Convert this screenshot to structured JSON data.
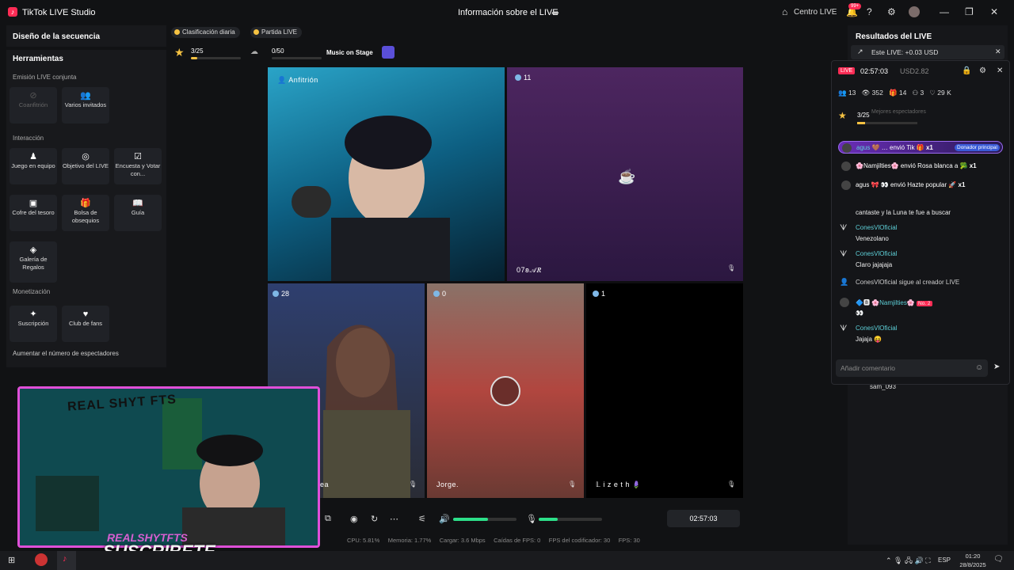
{
  "app": {
    "title": "TikTok LIVE Studio",
    "logo": "tiktok-logo"
  },
  "header": {
    "center_title": "Información sobre el LIVE",
    "centro": "Centro LIVE",
    "notif_badge": "99+"
  },
  "sidebar": {
    "sequence_title": "Diseño de la secuencia",
    "tools_title": "Herramientas",
    "joint_live": "Emisión LIVE conjunta",
    "cohost": "Coanfitrión",
    "multi_guest": "Varios invitados",
    "interaction": "Interacción",
    "team_game": "Juego en equipo",
    "live_goal": "Objetivo del LIVE",
    "poll": "Encuesta y Votar con...",
    "treasure": "Cofre del tesoro",
    "gift_bag": "Bolsa de obsequios",
    "guide": "Guía",
    "gift_gallery": "Galería de Regalos",
    "monetization": "Monetización",
    "subscription": "Suscripción",
    "fan_club": "Club de fans",
    "increase_viewers": "Aumentar el número de espectadores"
  },
  "chips": {
    "daily_rank": "Clasificación diaria",
    "live_match": "Partida LIVE"
  },
  "goals": {
    "stars": "3/25",
    "progress": "0/50",
    "music": "Music on Stage"
  },
  "grid": {
    "host_label": "Anfitrión",
    "guest1_viewers": "11",
    "guest1_name": "07𐐪𝒜𝑅",
    "guest2_viewers": "28",
    "guest2_name": "ea",
    "guest3_viewers": "0",
    "guest3_name": "Jorge.",
    "guest4_viewers": "1",
    "guest4_name": "𝕃 i z e t h 🪻",
    "banner_real": "REAL SHYT FTS"
  },
  "controls": {
    "timer": "02:57:03",
    "volume_pct": 0.55,
    "mic_pct": 0.3
  },
  "stats": {
    "cpu": "CPU: 5.81%",
    "mem": "Memoria: 1.77%",
    "load": "Cargar: 3.6 Mbps",
    "fps_drops": "Caídas de FPS: 0",
    "encoder_fps": "FPS del codificador: 30",
    "fps": "FPS: 30"
  },
  "right": {
    "results_title": "Resultados del LIVE",
    "this_live": "Este LIVE: +0.03 USD",
    "popup_timer": "02:57:03",
    "usd": "USD2.82",
    "live_badge": "LIVE",
    "viewers_stat": "13",
    "views_stat": "352",
    "gifts_stat": "14",
    "hosts_stat": "3",
    "likes_stat": "29 K",
    "popup_stars": "3/25",
    "best_viewers": "Mejores espectadores",
    "gift1_user": "agus",
    "gift1_text": "envió Tik",
    "gift1_count": "x1",
    "gift1_badge": "Donador principal",
    "gift2_user": "Namjilties",
    "gift2_text": "envió Rosa blanca a",
    "gift2_count": "x1",
    "gift3_user": "agus",
    "gift3_text": "envió Hazte popular",
    "gift3_count": "x1",
    "c0_text": "cantaste y la Luna te fue a buscar",
    "c1_user": "ConesVlOficial",
    "c1_text": "Venezolano",
    "c2_user": "ConesVlOficial",
    "c2_text": "Claro jajajaja",
    "c3_text": "ConesVlOficial  sigue al creador LIVE",
    "c4_user": "Namjilties",
    "c4_badge": "No. 2",
    "c4_text": "👀",
    "c5_user": "ConesVlOficial",
    "c5_text": "Jajaja 😝",
    "comment_placeholder": "Añadir comentario",
    "bottom_user": "sam_093"
  },
  "webcam": {
    "banner_name": "REALSHYTFTS",
    "subscribe": "SUSCRIBETE"
  },
  "taskbar": {
    "lang": "ESP",
    "time": "01:20",
    "date": "28/8/2025"
  },
  "colors": {
    "accent": "#fe2c55",
    "teal": "#5ed0d8",
    "progress": "#2de08a",
    "frame": "#e04fd8"
  }
}
